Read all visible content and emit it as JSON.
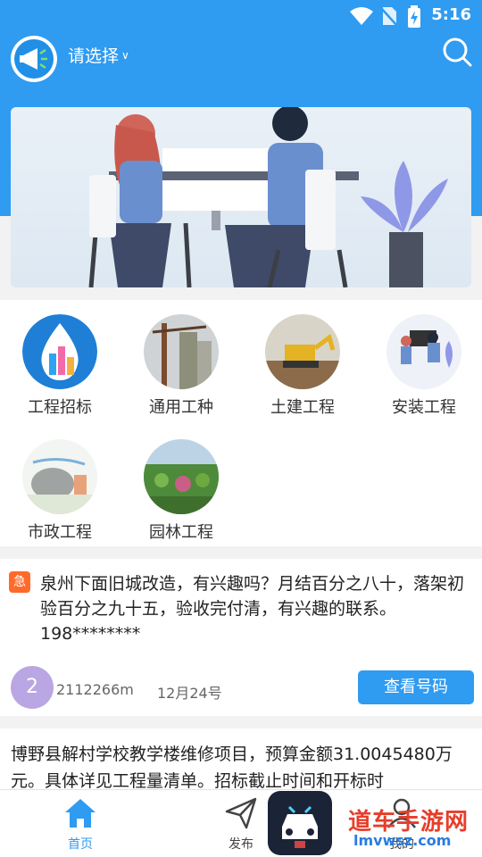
{
  "status_bar": {
    "time": "5:16",
    "wifi_icon": "wifi-icon",
    "sim_icon": "no-sim-icon",
    "battery_icon": "battery-charging-icon"
  },
  "header": {
    "city_select": "请选择",
    "search_icon": "search-icon"
  },
  "categories": [
    {
      "label": "工程招标"
    },
    {
      "label": "通用工种"
    },
    {
      "label": "土建工程"
    },
    {
      "label": "安装工程"
    },
    {
      "label": "市政工程"
    },
    {
      "label": "园林工程"
    }
  ],
  "posts": [
    {
      "badge": "急",
      "text": "泉州下面旧城改造，有兴趣吗？月结百分之八十，落架初验百分之九十五，验收完付清，有兴趣的联系。198********",
      "avatar_text": "2",
      "phone": "2112266m",
      "date": "12月24号",
      "button": "查看号码"
    },
    {
      "text": "博野县解村学校教学楼维修项目，预算金额31.0045480万元。具体详见工程量清单。招标截止时间和开标时"
    }
  ],
  "bottom_nav": [
    {
      "label": "首页",
      "icon": "home-icon"
    },
    {
      "label": "发布",
      "icon": "send-icon"
    },
    {
      "label": "我的",
      "icon": "user-icon"
    }
  ],
  "watermark": {
    "name": "道车手游网",
    "url": "lmvwsz.com"
  },
  "colors": {
    "primary": "#2f9bf1",
    "urgent": "#ff6a2b",
    "avatar": "#b9a6e2"
  }
}
